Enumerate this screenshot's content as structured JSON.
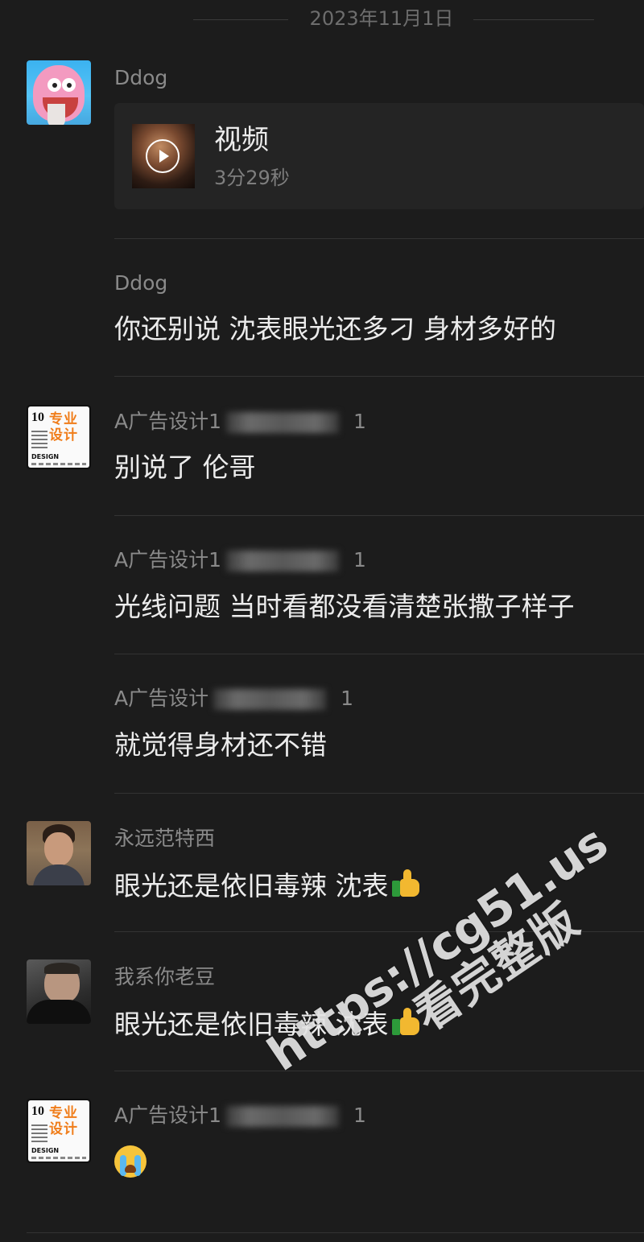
{
  "date_header": "2023年11月1日",
  "messages": [
    {
      "sender": "Ddog",
      "video": {
        "title": "视频",
        "duration": "3分29秒"
      }
    },
    {
      "sender": "Ddog",
      "text": "你还别说 沈表眼光还多刁 身材多好的"
    },
    {
      "sender_prefix": "A广告设计1",
      "sender_suffix": "1",
      "text": "别说了 伦哥"
    },
    {
      "sender_prefix": "A广告设计1",
      "sender_suffix": "1",
      "text": "光线问题 当时看都没看清楚张撒子样子"
    },
    {
      "sender_prefix": "A广告设计",
      "sender_suffix": "1",
      "text": "就觉得身材还不错"
    },
    {
      "sender": "永远范特西",
      "text": "眼光还是依旧毒辣 沈表",
      "emoji": "thumbs-up"
    },
    {
      "sender": "我系你老豆",
      "text": "眼光还是依旧毒辣 沈表",
      "emoji": "thumbs-up"
    },
    {
      "sender_prefix": "A广告设计1",
      "sender_suffix": "1",
      "emoji": "loudly-crying-face"
    }
  ],
  "avatars": {
    "ddog": "patrick-star-avatar",
    "design": {
      "num": "10",
      "big_text": "专业设计",
      "footer": "DESIGN"
    },
    "fantasy": "child-photo-avatar",
    "dad": "man-photo-avatar"
  },
  "watermark": {
    "url": "https://cg51.us",
    "text": "看完整版"
  }
}
